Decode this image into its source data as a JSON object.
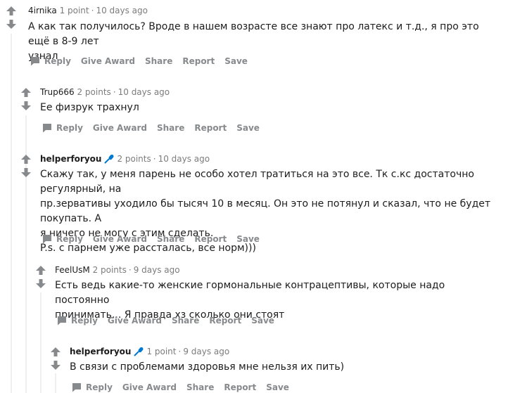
{
  "actions": {
    "reply": "Reply",
    "give_award": "Give Award",
    "share": "Share",
    "report": "Report",
    "save": "Save"
  },
  "comments": [
    {
      "author": "4irnika",
      "points": "1 point",
      "time": "10 days ago",
      "body": [
        "А как так получилось? Вроде в нашем возрасте все знают про латекс и т.д., я про это ещё в 8-9 лет",
        "узнал"
      ]
    },
    {
      "author": "Trup666",
      "points": "2 points",
      "time": "10 days ago",
      "body": [
        "Ее физрук трахнул"
      ]
    },
    {
      "author": "helperforyou",
      "points": "2 points",
      "time": "10 days ago",
      "body": [
        "Скажу так, у меня парень не особо хотел тратиться на это все. Тк с.кс достаточно регулярный, на",
        "пр.зервативы уходило бы тысяч 10 в месяц. Он это не потянул и сказал, что не будет покупать. А",
        "я ничего не могу с этим сделать.",
        "P.s. с парнем уже рассталась, все норм)))"
      ]
    },
    {
      "author": "FeelUsM",
      "points": "2 points",
      "time": "9 days ago",
      "body": [
        "Есть ведь какие-то женские гормональные контрацептивы, которые надо постоянно",
        "принимать... Я правда хз сколько они стоят"
      ]
    },
    {
      "author": "helperforyou",
      "points": "1 point",
      "time": "9 days ago",
      "body": [
        "В связи с проблемами здоровья мне нельзя их пить)"
      ]
    }
  ],
  "colors": {
    "accent_mic": "#0079d3",
    "muted": "#878a8c",
    "text": "#1c1c1c",
    "thread_line": "#edeff1"
  }
}
